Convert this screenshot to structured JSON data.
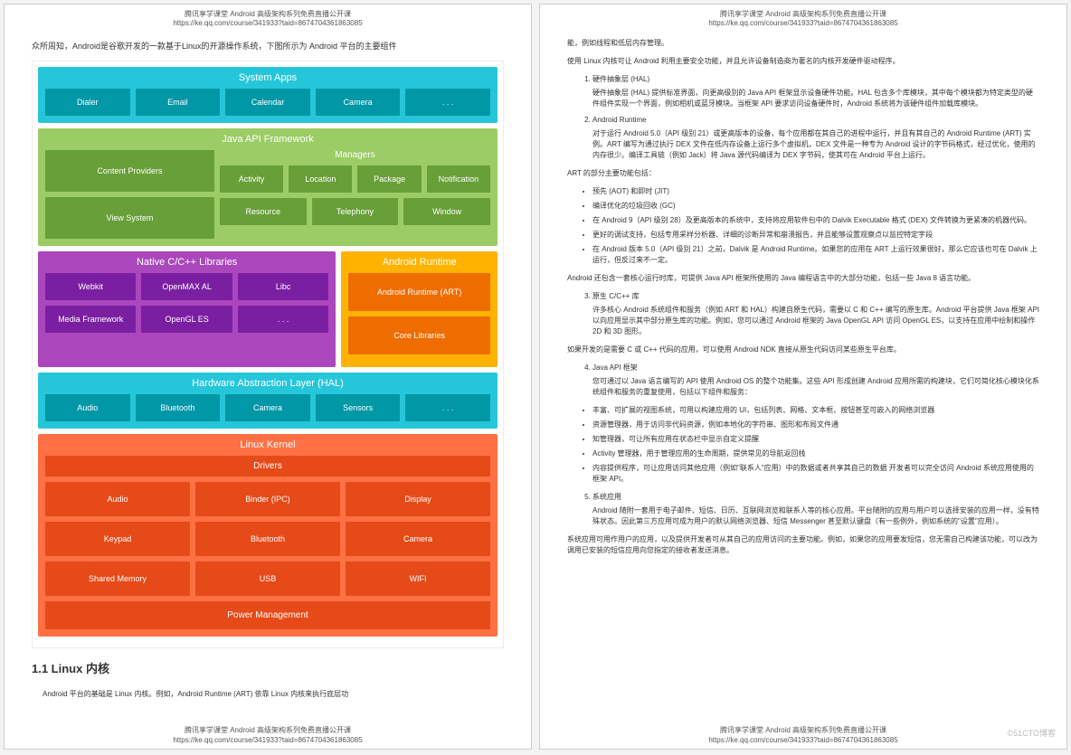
{
  "header": {
    "line1": "腾讯享学课堂 Android 高级架构系列免费直播公开课",
    "line2": "https://ke.qq.com/course/341933?taid=8674704361863085"
  },
  "page1": {
    "intro": "众所周知，Android是谷歌开发的一款基于Linux的开源操作系统，下图所示为 Android 平台的主要组件",
    "diagram": {
      "systemApps": {
        "title": "System Apps",
        "items": [
          "Dialer",
          "Email",
          "Calendar",
          "Camera",
          ". . ."
        ]
      },
      "javaFramework": {
        "title": "Java API Framework",
        "left": [
          "Content Providers",
          "View System"
        ],
        "managersTitle": "Managers",
        "managersRow1": [
          "Activity",
          "Location",
          "Package",
          "Notification"
        ],
        "managersRow2": [
          "Resource",
          "Telephony",
          "Window"
        ]
      },
      "native": {
        "title": "Native C/C++ Libraries",
        "row1": [
          "Webkit",
          "OpenMAX AL",
          "Libc"
        ],
        "row2": [
          "Media Framework",
          "OpenGL ES",
          ". . ."
        ]
      },
      "runtime": {
        "title": "Android Runtime",
        "items": [
          "Android Runtime (ART)",
          "Core Libraries"
        ]
      },
      "hal": {
        "title": "Hardware Abstraction Layer (HAL)",
        "items": [
          "Audio",
          "Bluetooth",
          "Camera",
          "Sensors",
          ". . ."
        ]
      },
      "kernel": {
        "title": "Linux Kernel",
        "driversTitle": "Drivers",
        "row1": [
          "Audio",
          "Binder (IPC)",
          "Display"
        ],
        "row2": [
          "Keypad",
          "Bluetooth",
          "Camera"
        ],
        "row3": [
          "Shared Memory",
          "USB",
          "WIFI"
        ],
        "pm": "Power Management"
      }
    },
    "sectionTitle": "1.1 Linux 内核",
    "bottomText": "Android 平台的基础是 Linux 内核。例如，Android Runtime (ART) 依靠 Linux 内核来执行底层功"
  },
  "page2": {
    "topLine": "能，例如线程和低层内存管理。",
    "para1": "使用 Linux 内核可让 Android 利用主要安全功能，并且允许设备制造商为著名的内核开发硬件驱动程序。",
    "list": [
      {
        "title": "硬件抽象层 (HAL)",
        "body": "硬件抽象层 (HAL) 提供标准界面，向更高级别的 Java API 框架显示设备硬件功能。HAL 包含多个库模块，其中每个模块都为特定类型的硬件组件实现一个界面，例如相机或蓝牙模块。当框架 API 要求访问设备硬件时，Android 系统将为该硬件组件加载库模块。"
      },
      {
        "title": "Android Runtime",
        "body": "对于运行 Android 5.0（API 级别 21）或更高版本的设备，每个应用都在其自己的进程中运行，并且有其自己的 Android Runtime (ART) 实例。ART 编写为通过执行 DEX 文件在低内存设备上运行多个虚拟机，DEX 文件是一种专为 Android 设计的字节码格式，经过优化，使用的内存很少。编译工具链（例如 Jack）将 Java 源代码编译为 DEX 字节码，使其可在 Android 平台上运行。"
      }
    ],
    "artIntro": "ART 的部分主要功能包括：",
    "artBullets": [
      "预先 (AOT) 和即时 (JIT)",
      "编译优化的垃圾回收 (GC)",
      "在 Android 9（API 级别 28）及更高版本的系统中，支持将应用软件包中的 Dalvik Executable 格式 (DEX) 文件转换为更紧凑的机器代码。",
      "更好的调试支持，包括专用采样分析器、详细的诊断异常和崩溃报告，并且能够设置观察点以监控特定字段",
      "在 Android 版本 5.0（API 级别 21）之前，Dalvik 是 Android Runtime。如果您的应用在 ART 上运行效果很好，那么它应该也可在 Dalvik 上运行，但反过来不一定。"
    ],
    "para2": "Android 还包含一套核心运行时库，可提供 Java API 框架所使用的 Java 编程语言中的大部分功能，包括一些 Java 8 语言功能。",
    "list2": [
      {
        "title": "原生 C/C++ 库",
        "body": "许多核心 Android 系统组件和服务（例如 ART 和 HAL）构建自原生代码，需要以 C 和 C++ 编写的原生库。Android 平台提供 Java 框架 API 以向应用显示其中部分原生库的功能。例如，您可以通过 Android 框架的 Java OpenGL API 访问 OpenGL ES，以支持在应用中绘制和操作 2D 和 3D 图形。"
      }
    ],
    "para3": "如果开发的是需要 C 或 C++ 代码的应用，可以使用 Android NDK 直接从原生代码访问某些原生平台库。",
    "list3": [
      {
        "title": "Java API 框架",
        "body": "您可通过以 Java 语言编写的 API 使用 Android OS 的整个功能集。这些 API 形成创建 Android 应用所需的构建块，它们可简化核心模块化系统组件和服务的重复使用，包括以下组件和服务："
      }
    ],
    "javaBullets": [
      "丰富、可扩展的视图系统，可用以构建应用的 UI，包括列表、网格、文本框、按钮甚至可嵌入的网络浏览器",
      "资源管理器，用于访问非代码资源，例如本地化的字符串、图形和布局文件通",
      "知管理器，可让所有应用在状态栏中显示自定义提醒",
      "Activity 管理器，用于管理应用的生命周期，提供常见的导航返回栈",
      "内容提供程序，可让应用访问其他应用（例如\"联系人\"应用）中的数据或者共享其自己的数据 开发者可以完全访问 Android 系统应用使用的框架 API。"
    ],
    "list4": [
      {
        "title": "系统应用",
        "body": "Android 随附一套用于电子邮件、短信、日历、互联网浏览和联系人等的核心应用。平台随附的应用与用户可以选择安装的应用一样，没有特殊状态。因此第三方应用可成为用户的默认网络浏览器、短信 Messenger 甚至默认键盘（有一些例外，例如系统的\"设置\"应用）。"
      }
    ],
    "para4": "系统应用可用作用户的应用，以及提供开发者可从其自己的应用访问的主要功能。例如，如果您的应用要发短信，您无需自己构建该功能，可以改为调用已安装的短信应用向您指定的接收者发送消息。"
  },
  "watermark": "©51CTO博客"
}
